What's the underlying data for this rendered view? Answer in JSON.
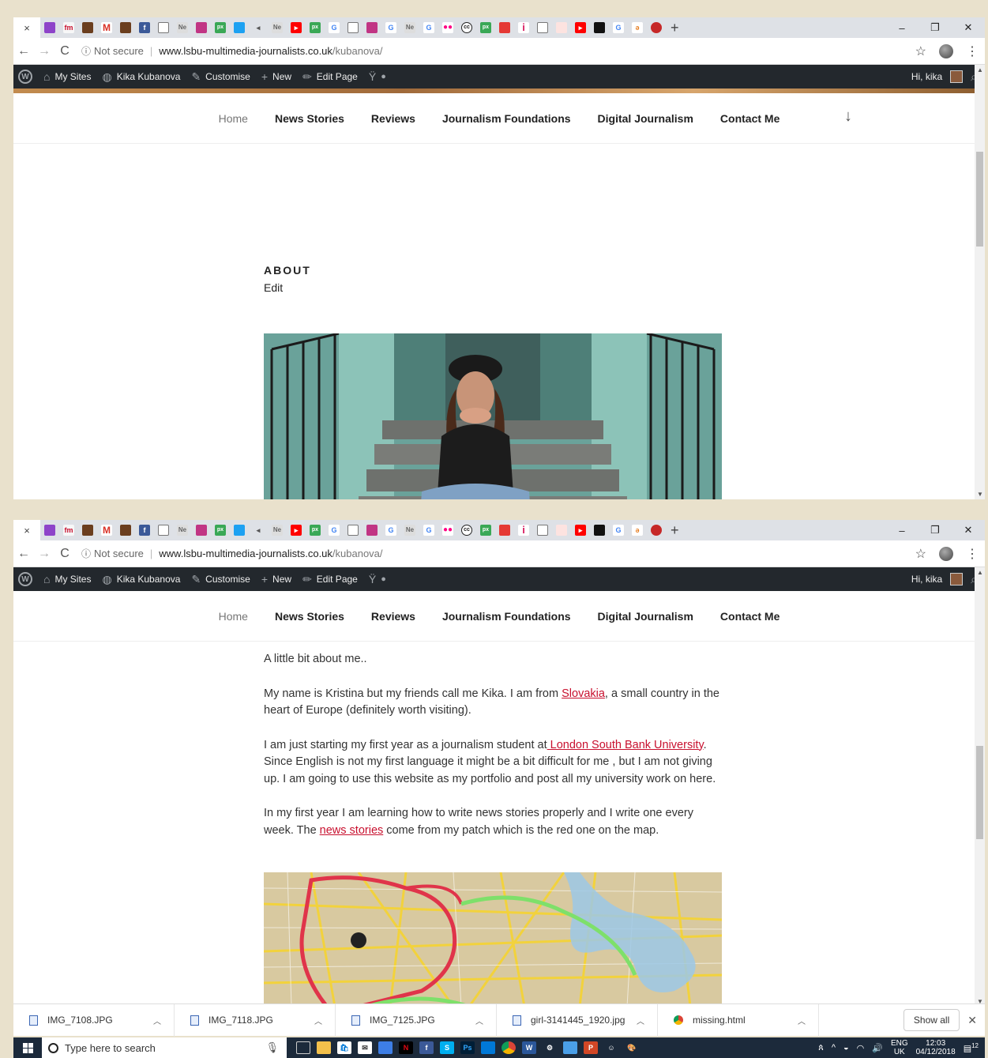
{
  "browser": {
    "tab_close": "×",
    "favicons": [
      "purple-square-icon",
      "fm-icon",
      "person-icon",
      "gmail-icon",
      "person-icon",
      "facebook-icon",
      "page-icon",
      "news-icon",
      "instagram-icon",
      "px-icon",
      "twitter-icon",
      "audio-icon",
      "news-icon",
      "youtube-icon",
      "px-icon",
      "google-icon",
      "page-icon",
      "instagram-icon",
      "google-icon",
      "news-icon",
      "google-icon",
      "flickr-icon",
      "cc-icon",
      "px-icon",
      "red-icon",
      "info-icon",
      "page-icon",
      "pdf-icon",
      "youtube-icon",
      "black-icon",
      "google-icon",
      "link-icon",
      "red-circle-icon"
    ],
    "new_tab": "+",
    "win_min": "–",
    "win_restore": "❐",
    "win_close": "✕",
    "not_secure": "Not secure",
    "url_domain": "www.lsbu-multimedia-journalists.co.uk",
    "url_path": "/kubanova/"
  },
  "wp_admin_bar": {
    "my_sites": "My Sites",
    "site_name": "Kika Kubanova",
    "customise": "Customise",
    "new": "New",
    "edit_page": "Edit Page",
    "greeting": "Hi, kika"
  },
  "site_menu": {
    "items": [
      "Home",
      "News Stories",
      "Reviews",
      "Journalism Foundations",
      "Digital Journalism",
      "Contact Me"
    ]
  },
  "page1": {
    "heading": "ABOUT",
    "edit": "Edit"
  },
  "page2": {
    "intro": "A little bit about me..",
    "p1_a": "My name is Kristina but my friends call me Kika. I am from ",
    "p1_link": "Slovakia",
    "p1_b": ", a small country in the heart of Europe (definitely worth visiting).",
    "p2_a": "I am just starting my first year as a journalism student at",
    "p2_link": " London South Bank University",
    "p2_b": ". Since English is not my first language it might be a bit difficult for me , but I am not giving up. I am going to use this website as my portfolio and post all my university  work on here.",
    "p3_a": "In my first year I am learning how to write news stories properly and  I write one every week. The ",
    "p3_link": "news stories",
    "p3_b": " come from my patch which is the red one on the map."
  },
  "downloads": {
    "files": [
      "IMG_7108.JPG",
      "IMG_7118.JPG",
      "IMG_7125.JPG",
      "girl-3141445_1920.jpg",
      "missing.html"
    ],
    "show_all": "Show all"
  },
  "taskbar": {
    "search_placeholder": "Type here to search",
    "lang": "ENG",
    "region": "UK",
    "time": "12:03",
    "date": "04/12/2018",
    "notifications": "12"
  },
  "colors": {
    "link": "#c8102e",
    "wp_bar": "#23282d",
    "page_bg": "#e9e1cc",
    "taskbar": "#1c2a3b"
  }
}
